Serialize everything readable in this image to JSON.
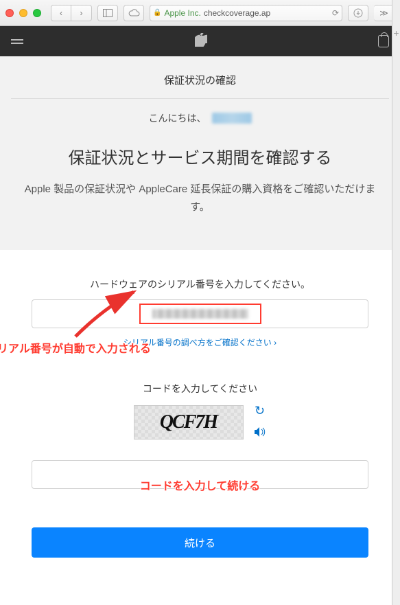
{
  "browser": {
    "url_prefix": "Apple Inc.",
    "url_domain": "checkcoverage.ap"
  },
  "header": {},
  "hero": {
    "title": "保証状況の確認",
    "greeting": "こんにちは、",
    "heading": "保証状況とサービス期間を確認する",
    "description": "Apple 製品の保証状況や AppleCare 延長保証の購入資格をご確認いただけます。"
  },
  "serial": {
    "label": "ハードウェアのシリアル番号を入力してください。",
    "help_link": "シリアル番号の調べ方をご確認ください ›"
  },
  "captcha": {
    "label": "コードを入力してください",
    "code": "QCF7H"
  },
  "annotations": {
    "serial_auto": "シリアル番号が自動で入力される",
    "code_continue": "コードを入力して続ける"
  },
  "actions": {
    "continue": "続ける"
  }
}
